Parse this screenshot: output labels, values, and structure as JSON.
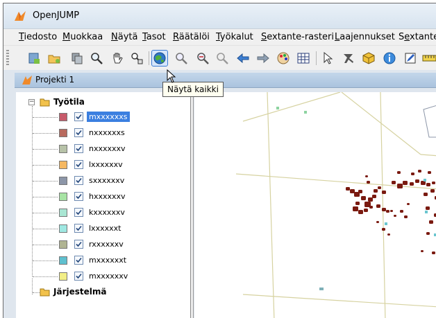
{
  "window": {
    "title": "OpenJUMP"
  },
  "menu": {
    "items": [
      "Tiedosto",
      "Muokkaa",
      "Näytä",
      "Tasot",
      "Räätälöi",
      "Työkalut",
      "Sextante-rasteri",
      "Laajennukset",
      "Sextante"
    ],
    "underline_letters": [
      "T",
      "M",
      "N",
      "T",
      "R",
      "T",
      "S",
      "L",
      "e"
    ]
  },
  "toolbar": {
    "buttons": [
      "add-layer-icon",
      "open-folder-icon",
      "copy-layer-icon",
      "zoom-icon",
      "pan-hand-icon",
      "zoom-pan-icon",
      "zoom-to-full-extent-icon",
      "zoom-in-icon",
      "zoom-out-icon",
      "zoom-to-selection-icon",
      "back-arrow-icon",
      "forward-arrow-icon",
      "palette-icon",
      "grid-icon",
      "select-icon",
      "tools-icon",
      "box-icon",
      "info-icon",
      "edit-icon",
      "measure-icon"
    ],
    "active_index": 6,
    "tooltip": "Näytä kaikki"
  },
  "project": {
    "title": "Projekti 1"
  },
  "tree": {
    "categories": [
      {
        "label": "Työtila",
        "expanded": true
      },
      {
        "label": "Järjestelmä",
        "expanded": false
      }
    ],
    "layers": [
      {
        "name": "mxxxxxxs",
        "color": "#c75a6a",
        "checked": true,
        "selected": true
      },
      {
        "name": "nxxxxxxs",
        "color": "#b86a5e",
        "checked": true,
        "selected": false
      },
      {
        "name": "nxxxxxxv",
        "color": "#b7c2a8",
        "checked": true,
        "selected": false
      },
      {
        "name": "lxxxxxxv",
        "color": "#f5b862",
        "checked": true,
        "selected": false
      },
      {
        "name": "sxxxxxxv",
        "color": "#8c96a8",
        "checked": true,
        "selected": false
      },
      {
        "name": "hxxxxxxv",
        "color": "#a7e3a4",
        "checked": true,
        "selected": false
      },
      {
        "name": "kxxxxxxv",
        "color": "#a9e6d3",
        "checked": true,
        "selected": false
      },
      {
        "name": "lxxxxxxt",
        "color": "#9fe8e2",
        "checked": true,
        "selected": false
      },
      {
        "name": "rxxxxxxv",
        "color": "#b0b492",
        "checked": true,
        "selected": false
      },
      {
        "name": "mxxxxxxt",
        "color": "#5fc0cf",
        "checked": true,
        "selected": false
      },
      {
        "name": "mxxxxxxv",
        "color": "#f2ee86",
        "checked": true,
        "selected": false
      }
    ]
  },
  "colors": {
    "selection": "#3b7fe0",
    "map_lines": "#d6d2a0",
    "map_features": "#7a1a10"
  }
}
